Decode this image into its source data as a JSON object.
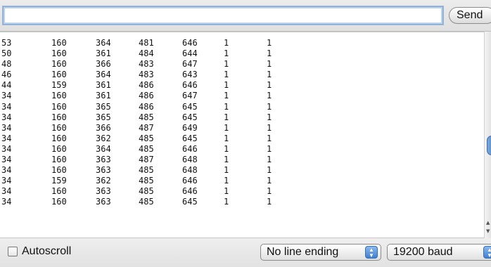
{
  "input": {
    "value": "",
    "placeholder": ""
  },
  "toolbar": {
    "send_label": "Send"
  },
  "output": {
    "rows": [
      [
        "53",
        "160",
        "364",
        "481",
        "646",
        "1",
        "1"
      ],
      [
        "50",
        "160",
        "361",
        "484",
        "644",
        "1",
        "1"
      ],
      [
        "48",
        "160",
        "366",
        "483",
        "647",
        "1",
        "1"
      ],
      [
        "46",
        "160",
        "364",
        "483",
        "643",
        "1",
        "1"
      ],
      [
        "44",
        "159",
        "361",
        "486",
        "646",
        "1",
        "1"
      ],
      [
        "34",
        "160",
        "361",
        "486",
        "647",
        "1",
        "1"
      ],
      [
        "34",
        "160",
        "365",
        "486",
        "645",
        "1",
        "1"
      ],
      [
        "34",
        "160",
        "365",
        "485",
        "645",
        "1",
        "1"
      ],
      [
        "34",
        "160",
        "366",
        "487",
        "649",
        "1",
        "1"
      ],
      [
        "34",
        "160",
        "362",
        "485",
        "645",
        "1",
        "1"
      ],
      [
        "34",
        "160",
        "364",
        "485",
        "646",
        "1",
        "1"
      ],
      [
        "34",
        "160",
        "363",
        "487",
        "648",
        "1",
        "1"
      ],
      [
        "34",
        "160",
        "363",
        "485",
        "648",
        "1",
        "1"
      ],
      [
        "34",
        "159",
        "362",
        "485",
        "646",
        "1",
        "1"
      ],
      [
        "34",
        "160",
        "363",
        "485",
        "646",
        "1",
        "1"
      ],
      [
        "34",
        "160",
        "363",
        "485",
        "645",
        "1",
        "1"
      ]
    ]
  },
  "footer": {
    "autoscroll_label": "Autoscroll",
    "autoscroll_checked": false,
    "line_ending_value": "No line ending",
    "baud_value": "19200 baud"
  },
  "icons": {
    "select_arrows": "updown-chevron-icon",
    "scroll_up": "scroll-up-arrow-icon",
    "scroll_down": "scroll-down-arrow-icon"
  },
  "colors": {
    "accent": "#3f7fd0",
    "output_background": "#ffffff",
    "window_background": "#e9e9e9"
  }
}
